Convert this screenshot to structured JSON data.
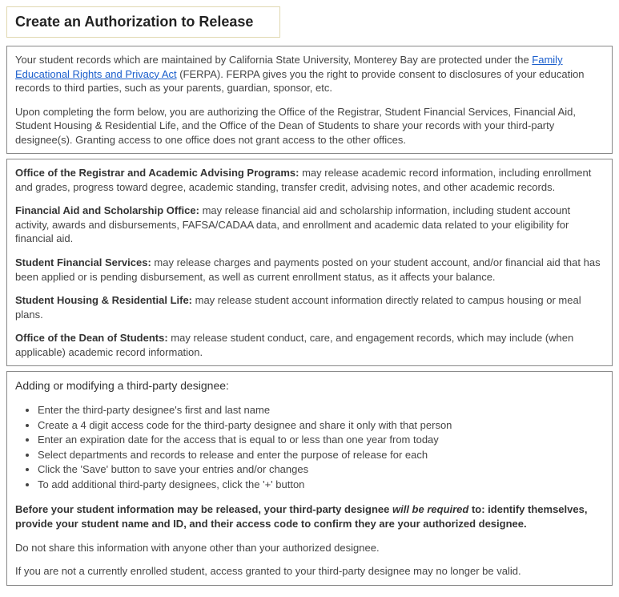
{
  "title": "Create an Authorization to Release",
  "intro": {
    "p1_a": "Your student records which are maintained by California State University, Monterey Bay are protected under the ",
    "ferpa_link": "Family Educational Rights and Privacy Act",
    "p1_b": " (FERPA). FERPA gives you the right to provide consent to disclosures of your education records to third parties, such as your parents, guardian, sponsor, etc.",
    "p2": "Upon completing the form below, you are authorizing the Office of the Registrar, Student Financial Services, Financial Aid, Student Housing & Residential Life, and the Office of the Dean of Students to share your records with your third-party designee(s). Granting access to one office does not grant access to the other offices."
  },
  "offices": {
    "registrar_label": "Office of the Registrar and Academic Advising Programs:",
    "registrar_text": " may release academic record information, including enrollment and grades, progress toward degree, academic standing, transfer credit, advising notes, and other academic records.",
    "finaid_label": "Financial Aid and Scholarship Office:",
    "finaid_text": " may release financial aid and scholarship information, including student account activity, awards and disbursements, FAFSA/CADAA data, and enrollment and academic data related to your eligibility for financial aid.",
    "sfs_label": "Student Financial Services:",
    "sfs_text": " may release charges and payments posted on your student account, and/or financial aid that has been applied or is pending disbursement, as well as current enrollment status, as it affects your balance.",
    "housing_label": "Student Housing & Residential Life:",
    "housing_text": " may release student account information directly related to campus housing or meal plans.",
    "dean_label": "Office of the Dean of Students:",
    "dean_text": " may release student conduct, care, and engagement records, which may include (when applicable) academic record information."
  },
  "instructions": {
    "heading": "Adding or modifying a third-party designee:",
    "steps": [
      "Enter the third-party designee's first and last name",
      "Create a 4 digit access code for the third-party designee and share it only with that person",
      "Enter an expiration date for the access that is equal to or less than one year from today",
      "Select departments and records to release and enter the purpose of release for each",
      "Click the 'Save' button to save your entries and/or changes",
      "To add additional third-party designees, click the '+' button"
    ],
    "req_a": "Before your student information may be released, your third-party designee ",
    "req_em": "will be required",
    "req_b": " to: identify themselves, provide your student name and ID, and their access code to confirm they are your authorized designee.",
    "no_share": "Do not share this information with anyone other than your authorized designee.",
    "not_enrolled": "If you are not a currently enrolled student, access granted to your third-party designee may no longer be valid."
  }
}
